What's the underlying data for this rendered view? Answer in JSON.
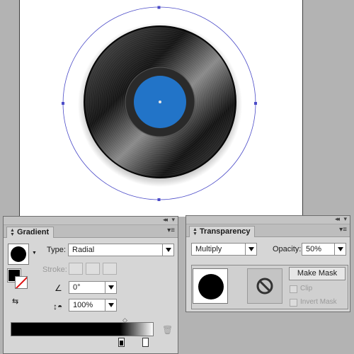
{
  "gradient_panel": {
    "tab_label": "Gradient",
    "type_label": "Type:",
    "type_value": "Radial",
    "stroke_label": "Stroke:",
    "angle_value": "0°",
    "aspect_value": "100%"
  },
  "transparency_panel": {
    "tab_label": "Transparency",
    "blend_mode": "Multiply",
    "opacity_label": "Opacity:",
    "opacity_value": "50%",
    "make_mask_label": "Make Mask",
    "clip_label": "Clip",
    "invert_mask_label": "Invert Mask"
  },
  "colors": {
    "record_label": "#2274c8",
    "selection": "#4b4bc8",
    "panel_bg": "#d6d6d6"
  },
  "icons": [
    "collapse-icon",
    "panel-menu-icon",
    "angle-icon",
    "aspect-ratio-icon",
    "trash-icon",
    "no-mask-icon",
    "reverse-gradient-icon"
  ]
}
